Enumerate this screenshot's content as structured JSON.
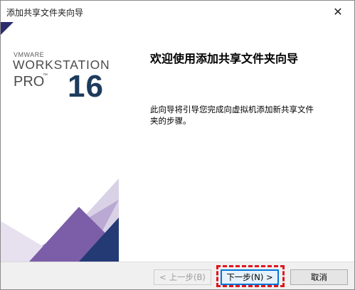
{
  "window": {
    "title": "添加共享文件夹向导",
    "close_glyph": "✕"
  },
  "brand": {
    "vendor": "VMWARE",
    "product": "WORKSTATION",
    "edition": "PRO",
    "trademark": "™",
    "version": "16"
  },
  "wizard": {
    "heading": "欢迎使用添加共享文件夹向导",
    "description": "此向导将引导您完成向虚拟机添加新共享文件夹的步骤。"
  },
  "buttons": {
    "back_label": "< 上一步(B)",
    "next_label": "下一步(N) >",
    "cancel_label": "取消"
  },
  "colors": {
    "accent": "#0078d7",
    "highlight": "#e0141e",
    "brand_navy": "#1d3b5c",
    "brand_purple": "#7b5ea7"
  }
}
